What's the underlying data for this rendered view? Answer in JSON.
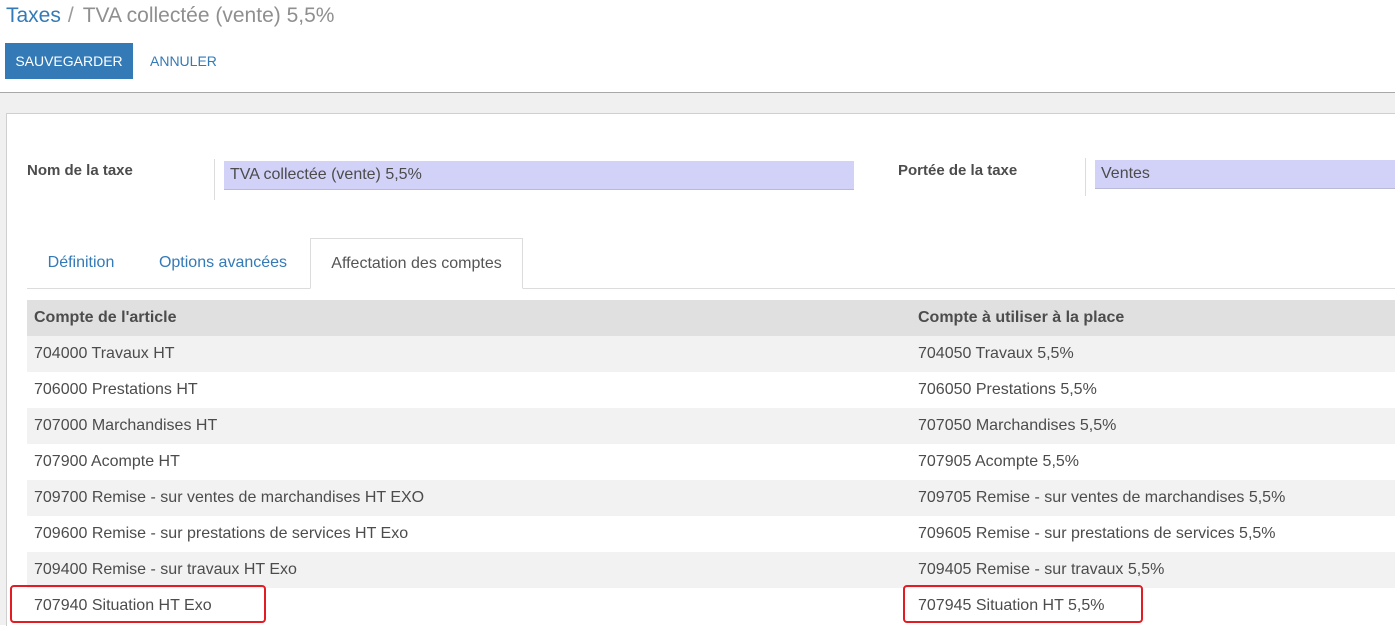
{
  "breadcrumb": {
    "parent": "Taxes",
    "separator": "/",
    "current": "TVA collectée (vente) 5,5%"
  },
  "buttons": {
    "save": "SAUVEGARDER",
    "cancel": "ANNULER"
  },
  "form": {
    "tax_name_label": "Nom de la taxe",
    "tax_name_value": "TVA collectée (vente) 5,5%",
    "tax_scope_label": "Portée de la taxe",
    "tax_scope_value": "Ventes"
  },
  "tabs": [
    {
      "label": "Définition",
      "active": false
    },
    {
      "label": "Options avancées",
      "active": false
    },
    {
      "label": "Affectation des comptes",
      "active": true
    }
  ],
  "table": {
    "headers": [
      "Compte de l'article",
      "Compte à utiliser à la place"
    ],
    "rows": [
      [
        "704000 Travaux HT",
        "704050 Travaux 5,5%"
      ],
      [
        "706000 Prestations HT",
        "706050 Prestations 5,5%"
      ],
      [
        "707000 Marchandises HT",
        "707050 Marchandises 5,5%"
      ],
      [
        "707900 Acompte HT",
        "707905 Acompte 5,5%"
      ],
      [
        "709700 Remise - sur ventes de marchandises HT EXO",
        "709705 Remise - sur ventes de marchandises 5,5%"
      ],
      [
        "709600 Remise - sur prestations de services HT Exo",
        "709605 Remise - sur prestations de services 5,5%"
      ],
      [
        "709400 Remise - sur travaux HT Exo",
        "709405 Remise - sur travaux 5,5%"
      ],
      [
        "707940 Situation HT Exo",
        "707945 Situation HT 5,5%"
      ]
    ]
  },
  "colors": {
    "primary": "#337ab7",
    "input_bg": "#d2d2f9",
    "highlight": "#e31b23",
    "header_bg": "#e0e0e0",
    "stripe_bg": "#f2f2f2"
  }
}
